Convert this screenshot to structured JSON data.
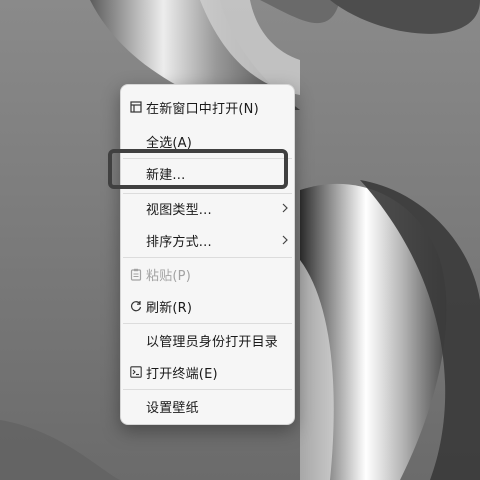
{
  "context_menu": {
    "items": [
      {
        "label": "在新窗口中打开(N)",
        "icon": "window-icon",
        "enabled": true
      },
      {
        "label": "全选(A)",
        "enabled": true
      },
      {
        "label": "新建...",
        "enabled": true,
        "highlighted": true
      },
      {
        "label": "视图类型...",
        "enabled": true,
        "submenu": true
      },
      {
        "label": "排序方式...",
        "enabled": true,
        "submenu": true
      },
      {
        "label": "粘贴(P)",
        "icon": "clipboard-icon",
        "enabled": false
      },
      {
        "label": "刷新(R)",
        "icon": "refresh-icon",
        "enabled": true
      },
      {
        "label": "以管理员身份打开目录",
        "enabled": true
      },
      {
        "label": "打开终端(E)",
        "icon": "terminal-icon",
        "enabled": true
      },
      {
        "label": "设置壁纸",
        "enabled": true
      }
    ]
  },
  "colors": {
    "menu_background": "#f6f6f6",
    "text": "#1a1a1a",
    "disabled_text": "#a3a3a3",
    "highlight_border": "#404040"
  }
}
